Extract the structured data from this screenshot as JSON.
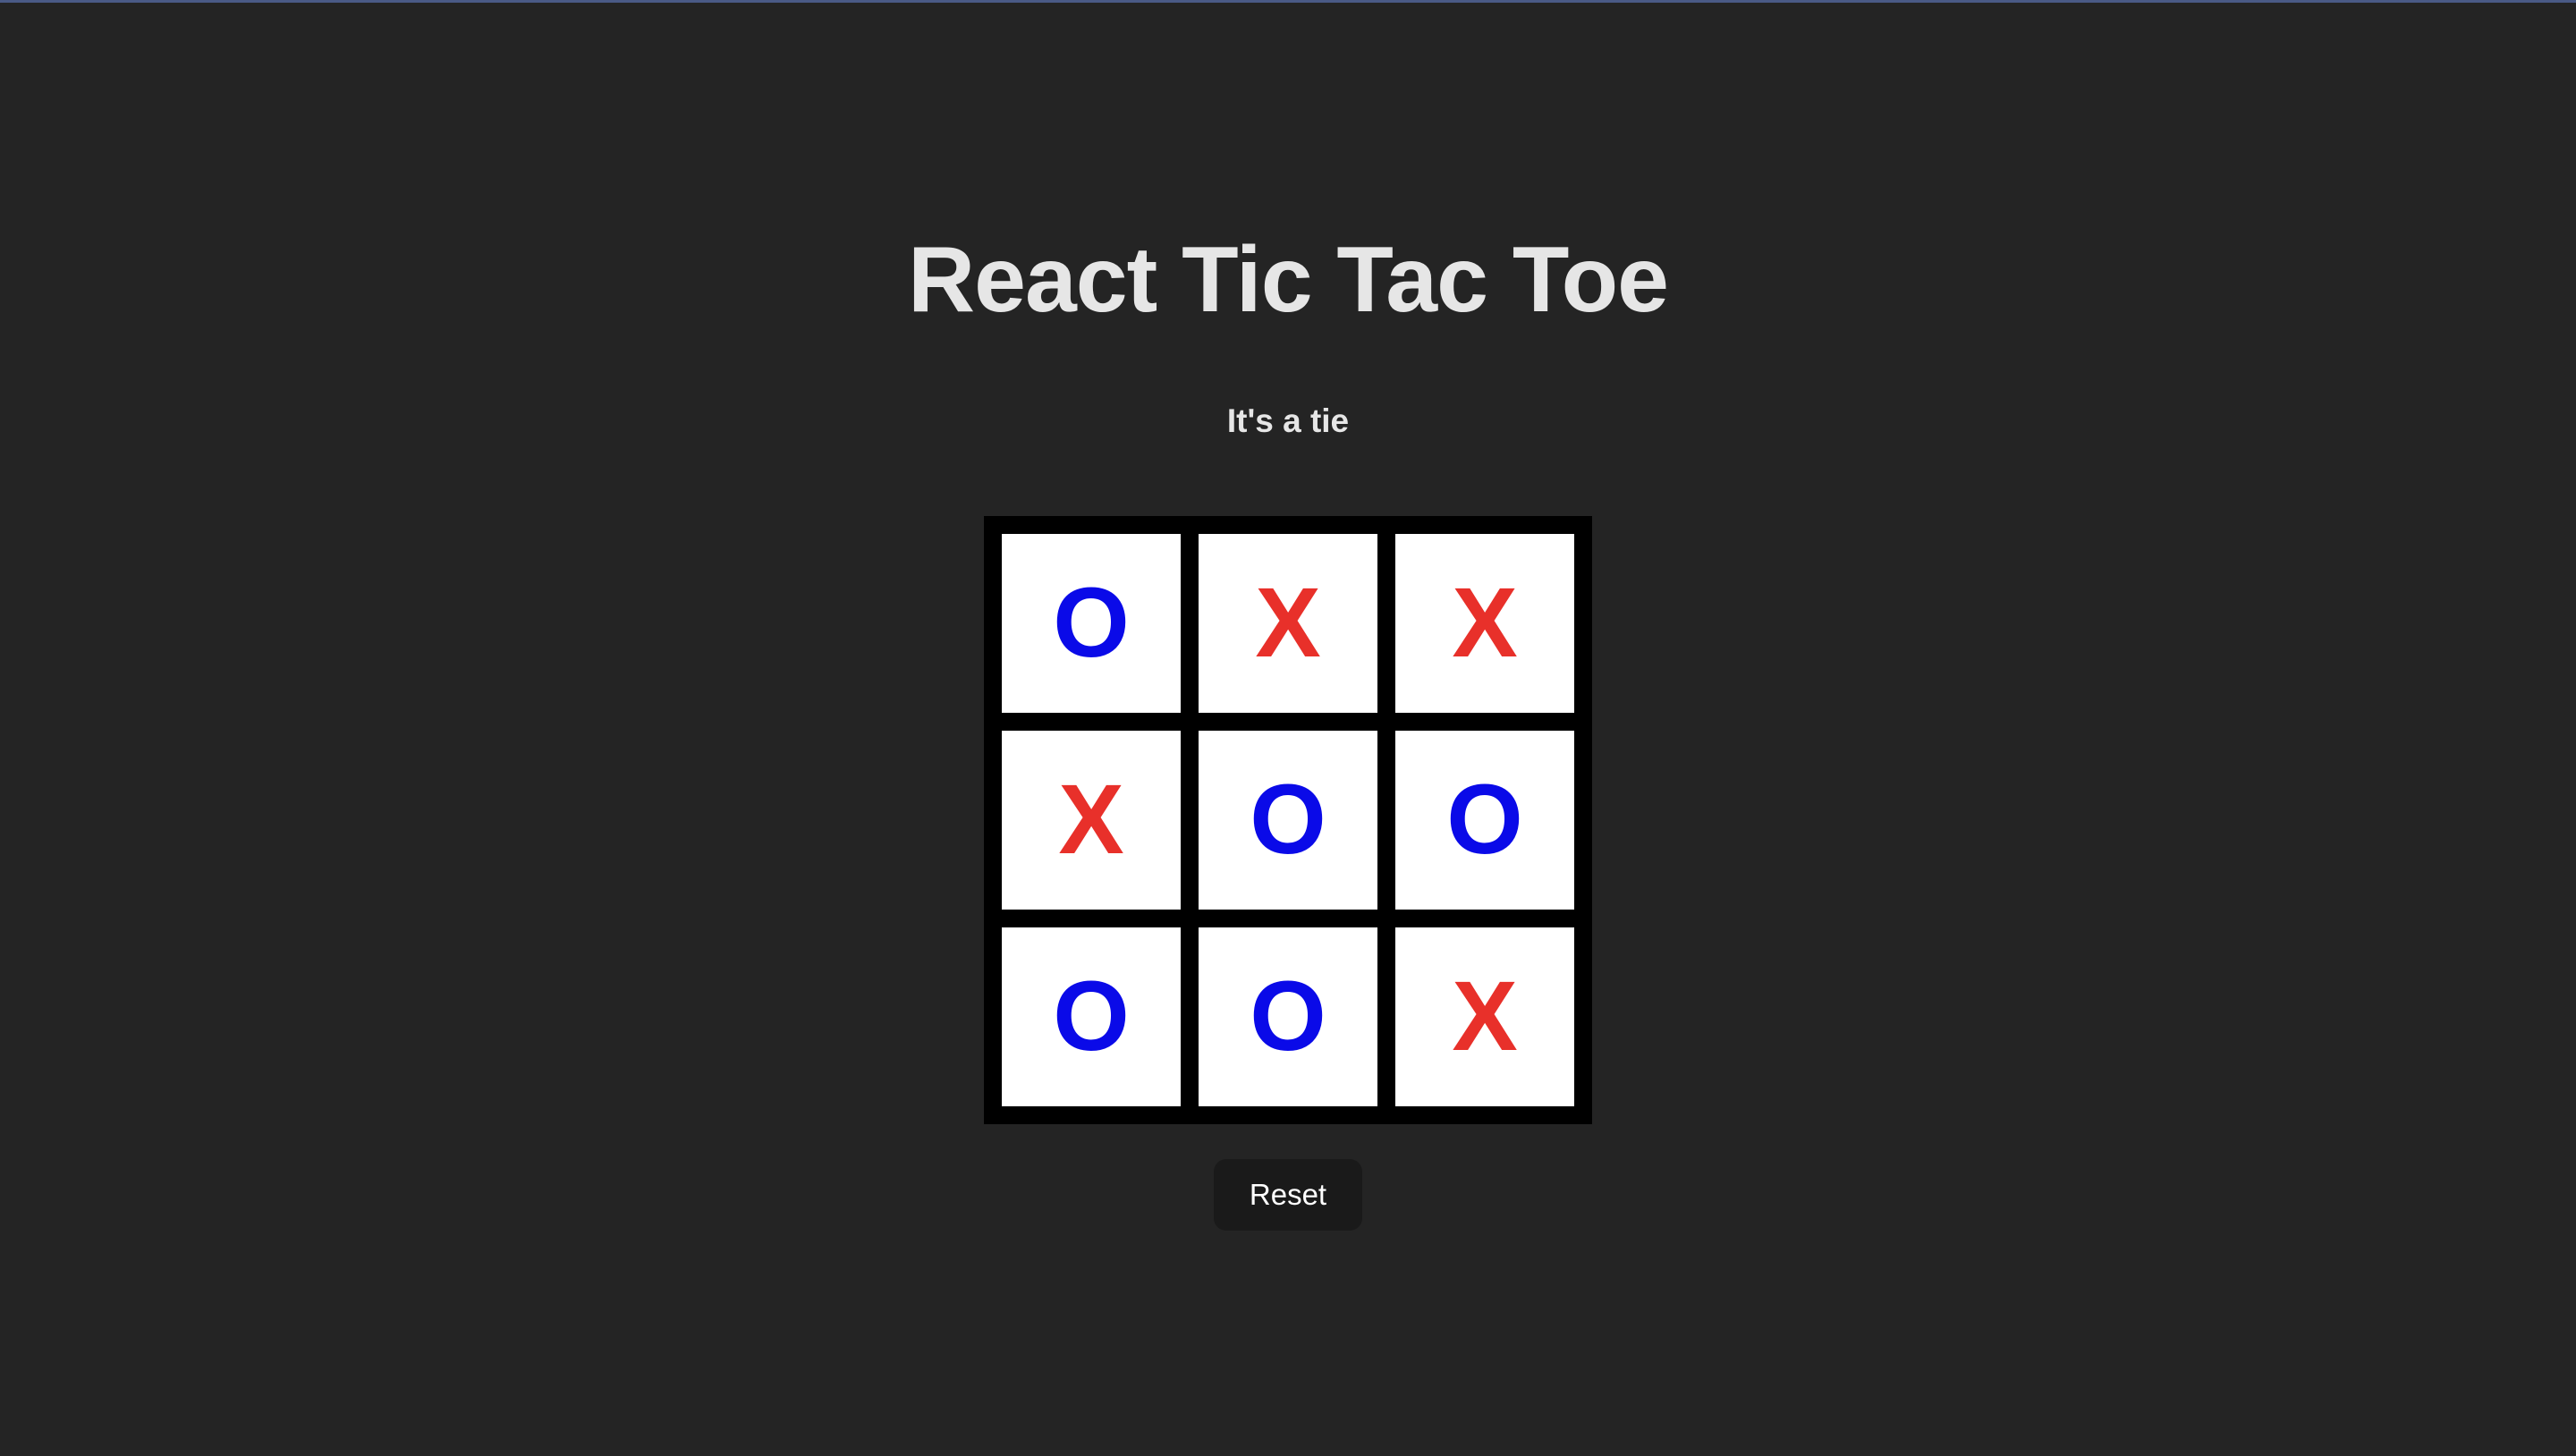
{
  "app": {
    "title": "React Tic Tac Toe",
    "status": "It's a tie"
  },
  "board": {
    "cells": [
      "O",
      "X",
      "X",
      "X",
      "O",
      "O",
      "O",
      "O",
      "X"
    ],
    "colors": {
      "X": "#e8302a",
      "O": "#0a0ae8"
    }
  },
  "controls": {
    "reset_label": "Reset"
  }
}
